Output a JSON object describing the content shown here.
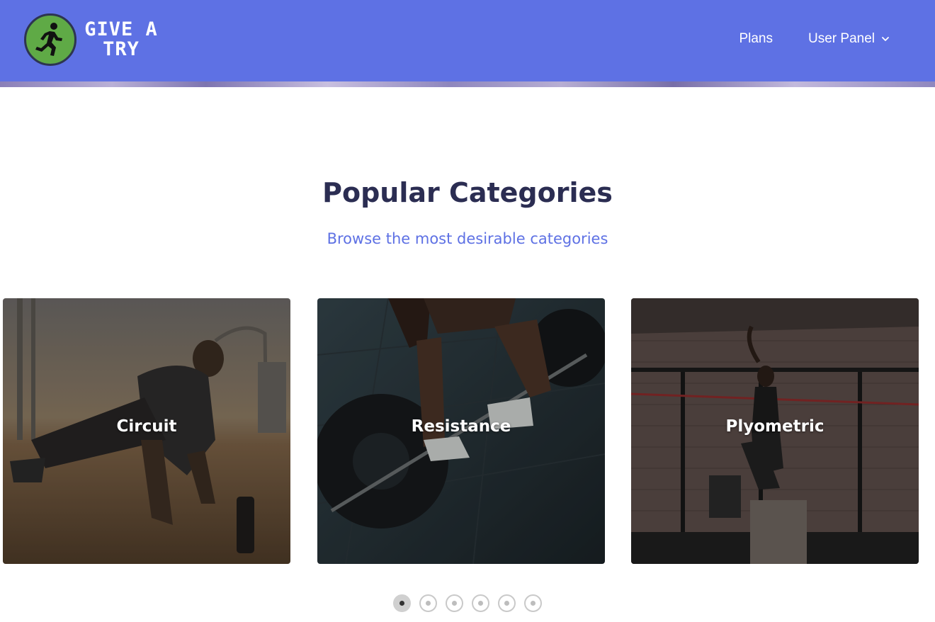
{
  "header": {
    "logo_line1": "GIVE A",
    "logo_line2": "TRY",
    "nav": [
      {
        "label": "Plans"
      },
      {
        "label": "User Panel"
      }
    ]
  },
  "section": {
    "title": "Popular Categories",
    "subtitle": "Browse the most desirable categories"
  },
  "categories": [
    {
      "label": "Circuit"
    },
    {
      "label": "Resistance"
    },
    {
      "label": "Plyometric"
    }
  ],
  "carousel": {
    "page_count": 6,
    "active_index": 0
  },
  "colors": {
    "brand": "#5e71e4",
    "heading": "#2b2d52",
    "logo_green": "#5faa46"
  }
}
